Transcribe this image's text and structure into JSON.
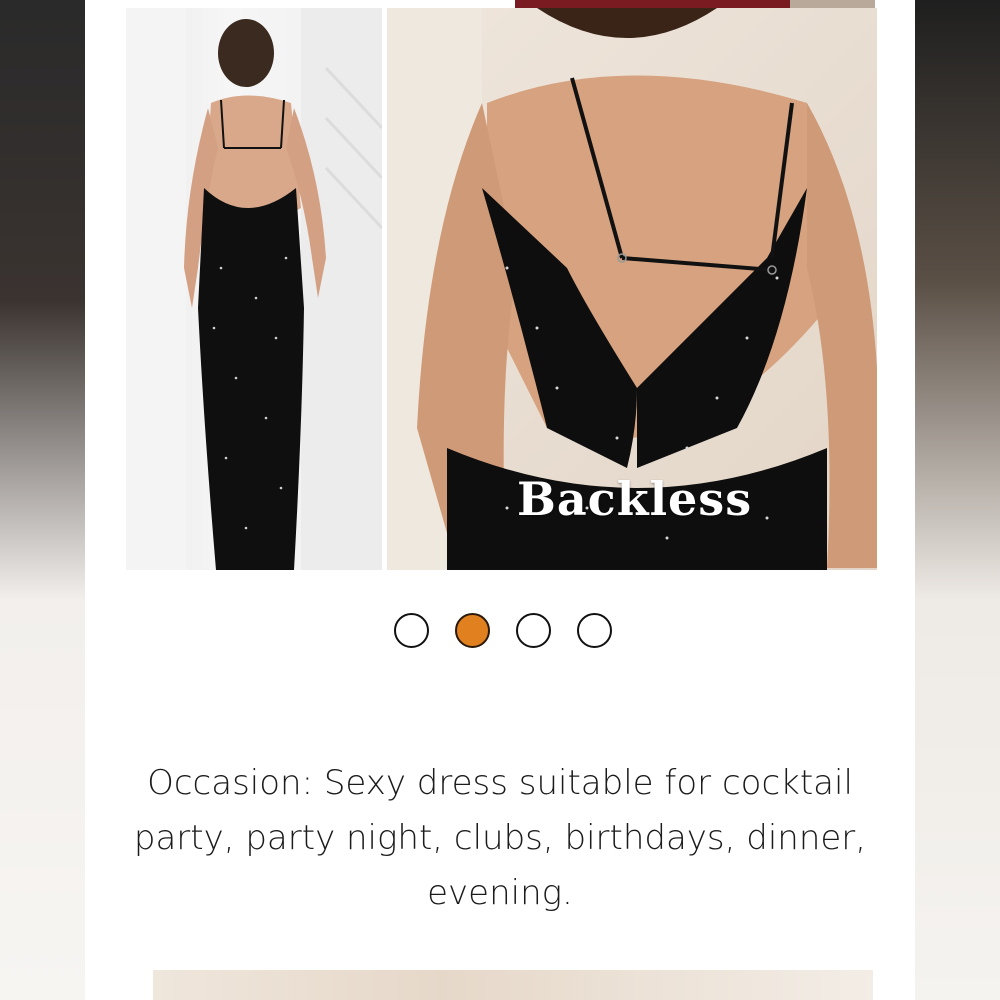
{
  "gallery": {
    "active_index": 1,
    "total_images": 4,
    "image_label": "Backless",
    "accent_color": "#e0801e"
  },
  "description": {
    "text": "Occasion: Sexy dress suitable for cocktail party, party night, clubs, birthdays, dinner, evening."
  }
}
